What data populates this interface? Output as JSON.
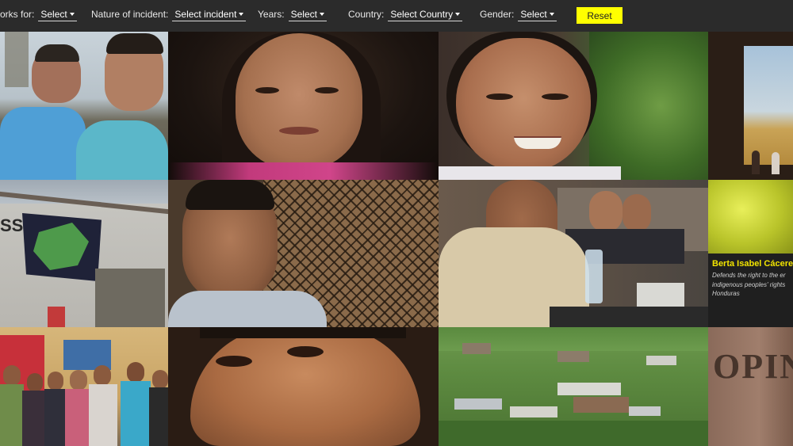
{
  "filters": {
    "works_for": {
      "label": "orks for:",
      "value": "Select"
    },
    "nature": {
      "label": "Nature of incident:",
      "value": "Select incident"
    },
    "years": {
      "label": "Years:",
      "value": "Select"
    },
    "country": {
      "label": "Country:",
      "value": "Select Country"
    },
    "gender": {
      "label": "Gender:",
      "value": "Select"
    },
    "reset_label": "Reset"
  },
  "featured": {
    "name": "Berta Isabel Cáceres",
    "description_line1": "Defends the right to the er",
    "description_line2": "indigenous peoples' rights",
    "country": "Honduras"
  },
  "tiles": [
    {
      "id": "tile-r1c1"
    },
    {
      "id": "tile-r1c2"
    },
    {
      "id": "tile-r1c3"
    },
    {
      "id": "tile-r1c4"
    },
    {
      "id": "tile-r2c1"
    },
    {
      "id": "tile-r2c2"
    },
    {
      "id": "tile-r2c3"
    },
    {
      "id": "tile-r2c4"
    },
    {
      "id": "tile-r3c1"
    },
    {
      "id": "tile-r3c2"
    },
    {
      "id": "tile-r3c3"
    },
    {
      "id": "tile-r3c4"
    }
  ],
  "wall_text_r2c1": "SS",
  "carved_text_r3c4": "OPIN",
  "colors": {
    "accent": "#ffff00",
    "name_yellow": "#f2e400",
    "bar_bg": "#2b2b2b"
  }
}
